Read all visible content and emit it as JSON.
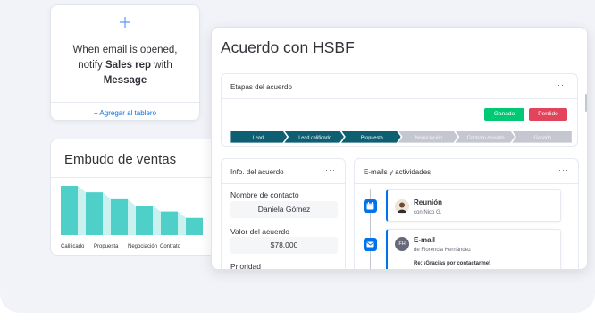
{
  "automation": {
    "plus_icon": "plus-icon",
    "line1": "When email is opened,",
    "line2_prefix": "notify ",
    "line2_bold": "Sales rep",
    "line2_suffix": " with",
    "line3_bold": "Message",
    "add_link": "+ Agregar al tablero"
  },
  "funnel": {
    "title": "Embudo de ventas",
    "labels": [
      "Calificado",
      "Propuesta",
      "Negociación",
      "Contrato"
    ],
    "bar_values": [
      100,
      87,
      73,
      59,
      48,
      35
    ],
    "colors": {
      "bar": "#4ecfc8",
      "shade": "#c9f1ef"
    }
  },
  "deal": {
    "title": "Acuerdo con HSBF",
    "stages_title": "Etapas del acuerdo",
    "more_icon": "more-icon",
    "won_label": "Ganado",
    "lost_label": "Perdido",
    "stages": [
      {
        "label": "Lead",
        "active": true
      },
      {
        "label": "Lead calificado",
        "active": true
      },
      {
        "label": "Propuesta",
        "active": true
      },
      {
        "label": "Negociación",
        "active": false
      },
      {
        "label": "Contrato enviado",
        "active": false
      },
      {
        "label": "Ganado",
        "active": false
      }
    ],
    "colors": {
      "active": "#0f5f73",
      "inactive": "#c5c7d0",
      "won": "#00c875",
      "lost": "#e2445c"
    }
  },
  "info": {
    "title": "Info. del acuerdo",
    "contact_label": "Nombre de contacto",
    "contact_value": "Daniela Gómez",
    "value_label": "Valor del acuerdo",
    "value_value": "$78,000",
    "priority_label": "Prioridad"
  },
  "activities": {
    "title": "E-mails y actividades",
    "items": [
      {
        "icon": "calendar-icon",
        "title": "Reunión",
        "subtitle": "con Nico G."
      },
      {
        "icon": "mail-icon",
        "title": "E-mail",
        "subtitle": "de Florencia Hernández",
        "avatar_initials": "FH",
        "snippet": "Re: ¡Gracias por contactarme!"
      }
    ]
  }
}
